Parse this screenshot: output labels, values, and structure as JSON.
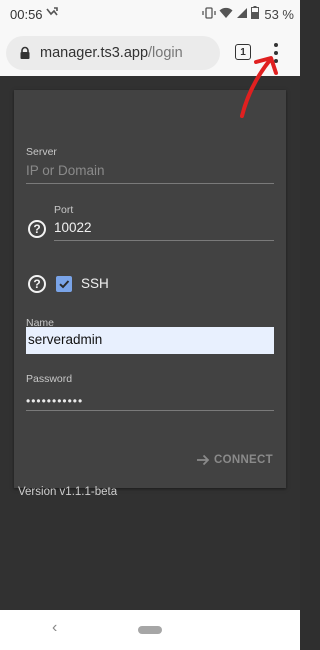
{
  "status_bar": {
    "time": "00:56",
    "battery": "53 %"
  },
  "browser": {
    "url_host": "manager.ts3.app",
    "url_path": "/login",
    "tab_count": "1"
  },
  "form": {
    "server_label": "Server",
    "server_placeholder": "IP or Domain",
    "port_label": "Port",
    "port_value": "10022",
    "ssh_label": "SSH",
    "ssh_checked": true,
    "name_label": "Name",
    "name_value": "serveradmin",
    "password_label": "Password",
    "password_value": "•••••••••••",
    "connect_label": "CONNECT",
    "version": "Version v1.1.1-beta"
  },
  "colors": {
    "accent_checkbox": "#7aa4e8",
    "annotation_arrow": "#e02020",
    "card_bg": "#424242",
    "page_bg": "#313131"
  }
}
